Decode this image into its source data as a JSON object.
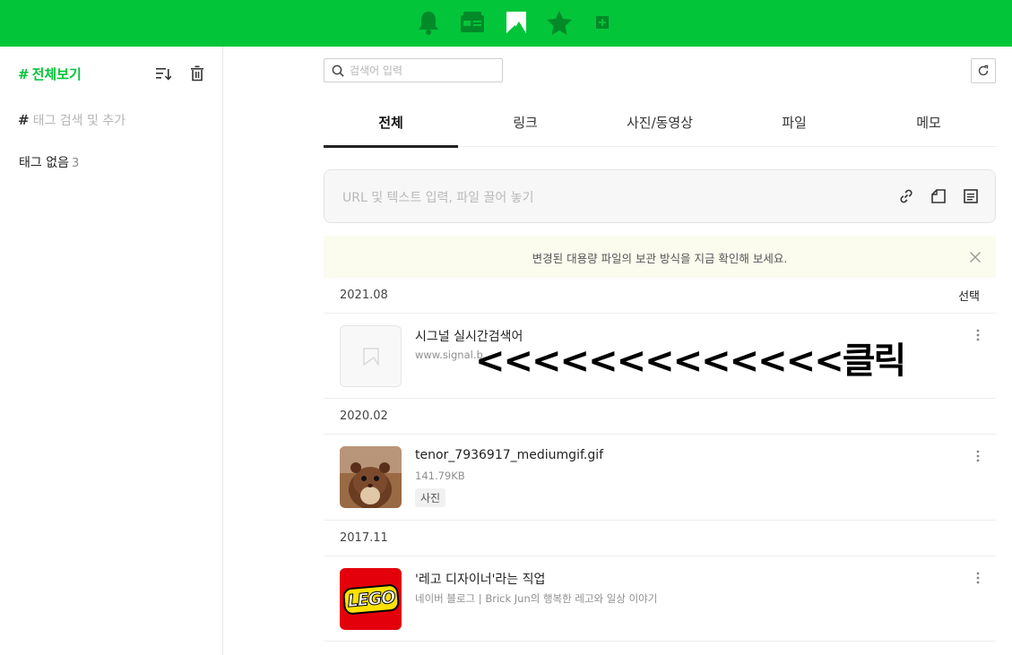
{
  "topbar": {
    "icons": [
      "bell-icon",
      "news-icon",
      "keep-logo-icon",
      "star-icon",
      "plus-square-icon"
    ]
  },
  "sidebar": {
    "title": "전체보기",
    "hash": "#",
    "tag_search_placeholder": "태그 검색 및 추가",
    "no_tag_label": "태그 없음",
    "no_tag_count": "3"
  },
  "search": {
    "placeholder": "검색어 입력"
  },
  "tabs": [
    {
      "label": "전체",
      "active": true
    },
    {
      "label": "링크"
    },
    {
      "label": "사진/동영상"
    },
    {
      "label": "파일"
    },
    {
      "label": "메모"
    }
  ],
  "input": {
    "placeholder": "URL 및 텍스트 입력, 파일 끌어 놓기"
  },
  "notice": {
    "text": "변경된 대용량 파일의 보관 방식을 지금 확인해 보세요."
  },
  "groups": [
    {
      "date": "2021.08",
      "select_label": "선택",
      "item": {
        "title": "시그널 실시간검색어",
        "sub": "www.signal.b"
      }
    },
    {
      "date": "2020.02",
      "item": {
        "title": "tenor_7936917_mediumgif.gif",
        "sub": "141.79KB",
        "badge": "사진"
      }
    },
    {
      "date": "2017.11",
      "item": {
        "title": "'레고 디자이너'라는 직업",
        "sub": "네이버 블로그 | Brick Jun의 행복한 레고와 일상 이야기",
        "logo_text": "LEGO"
      }
    }
  ],
  "overlay_text": "<<<<<<<<<<<<<클릭",
  "colors": {
    "brand_green": "#03c53a",
    "notice_bg": "#fbfbee"
  }
}
